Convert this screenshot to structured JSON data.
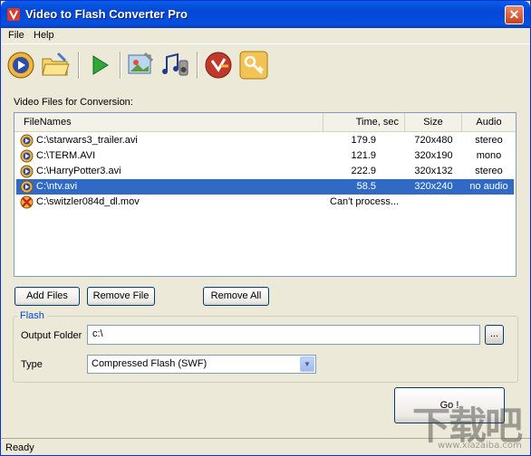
{
  "window": {
    "title": "Video to Flash Converter Pro",
    "close_label": "✕"
  },
  "menu": {
    "items": [
      "File",
      "Help"
    ]
  },
  "toolbar": {
    "icons": [
      "play-media-icon",
      "open-folder-icon",
      "start-convert-icon",
      "video-settings-icon",
      "audio-settings-icon",
      "flash-logo-icon",
      "register-key-icon"
    ]
  },
  "files_section": {
    "label": "Video Files for Conversion:",
    "columns": [
      "FileNames",
      "Time, sec",
      "Size",
      "Audio"
    ],
    "rows": [
      {
        "name": "C:\\starwars3_trailer.avi",
        "time": "179.9",
        "size": "720x480",
        "audio": "stereo",
        "status": "ok"
      },
      {
        "name": "C:\\TERM.AVI",
        "time": "121.9",
        "size": "320x190",
        "audio": "mono",
        "status": "ok"
      },
      {
        "name": "C:\\HarryPotter3.avi",
        "time": "222.9",
        "size": "320x132",
        "audio": "stereo",
        "status": "ok"
      },
      {
        "name": "C:\\ntv.avi",
        "time": "58.5",
        "size": "320x240",
        "audio": "no audio",
        "status": "ok",
        "selected": true
      },
      {
        "name": "C:\\switzler084d_dl.mov",
        "time": "Can't process...",
        "size": "",
        "audio": "",
        "status": "error"
      }
    ]
  },
  "buttons": {
    "add_files": "Add Files",
    "remove_file": "Remove File",
    "remove_all": "Remove All",
    "browse": "...",
    "go": "Go !"
  },
  "flash": {
    "group_title": "Flash",
    "output_label": "Output Folder",
    "output_value": "c:\\",
    "type_label": "Type",
    "type_value": "Compressed Flash (SWF)"
  },
  "status": {
    "text": "Ready"
  },
  "watermark": {
    "text": "下载吧",
    "url": "www.xiazaiba.com"
  }
}
